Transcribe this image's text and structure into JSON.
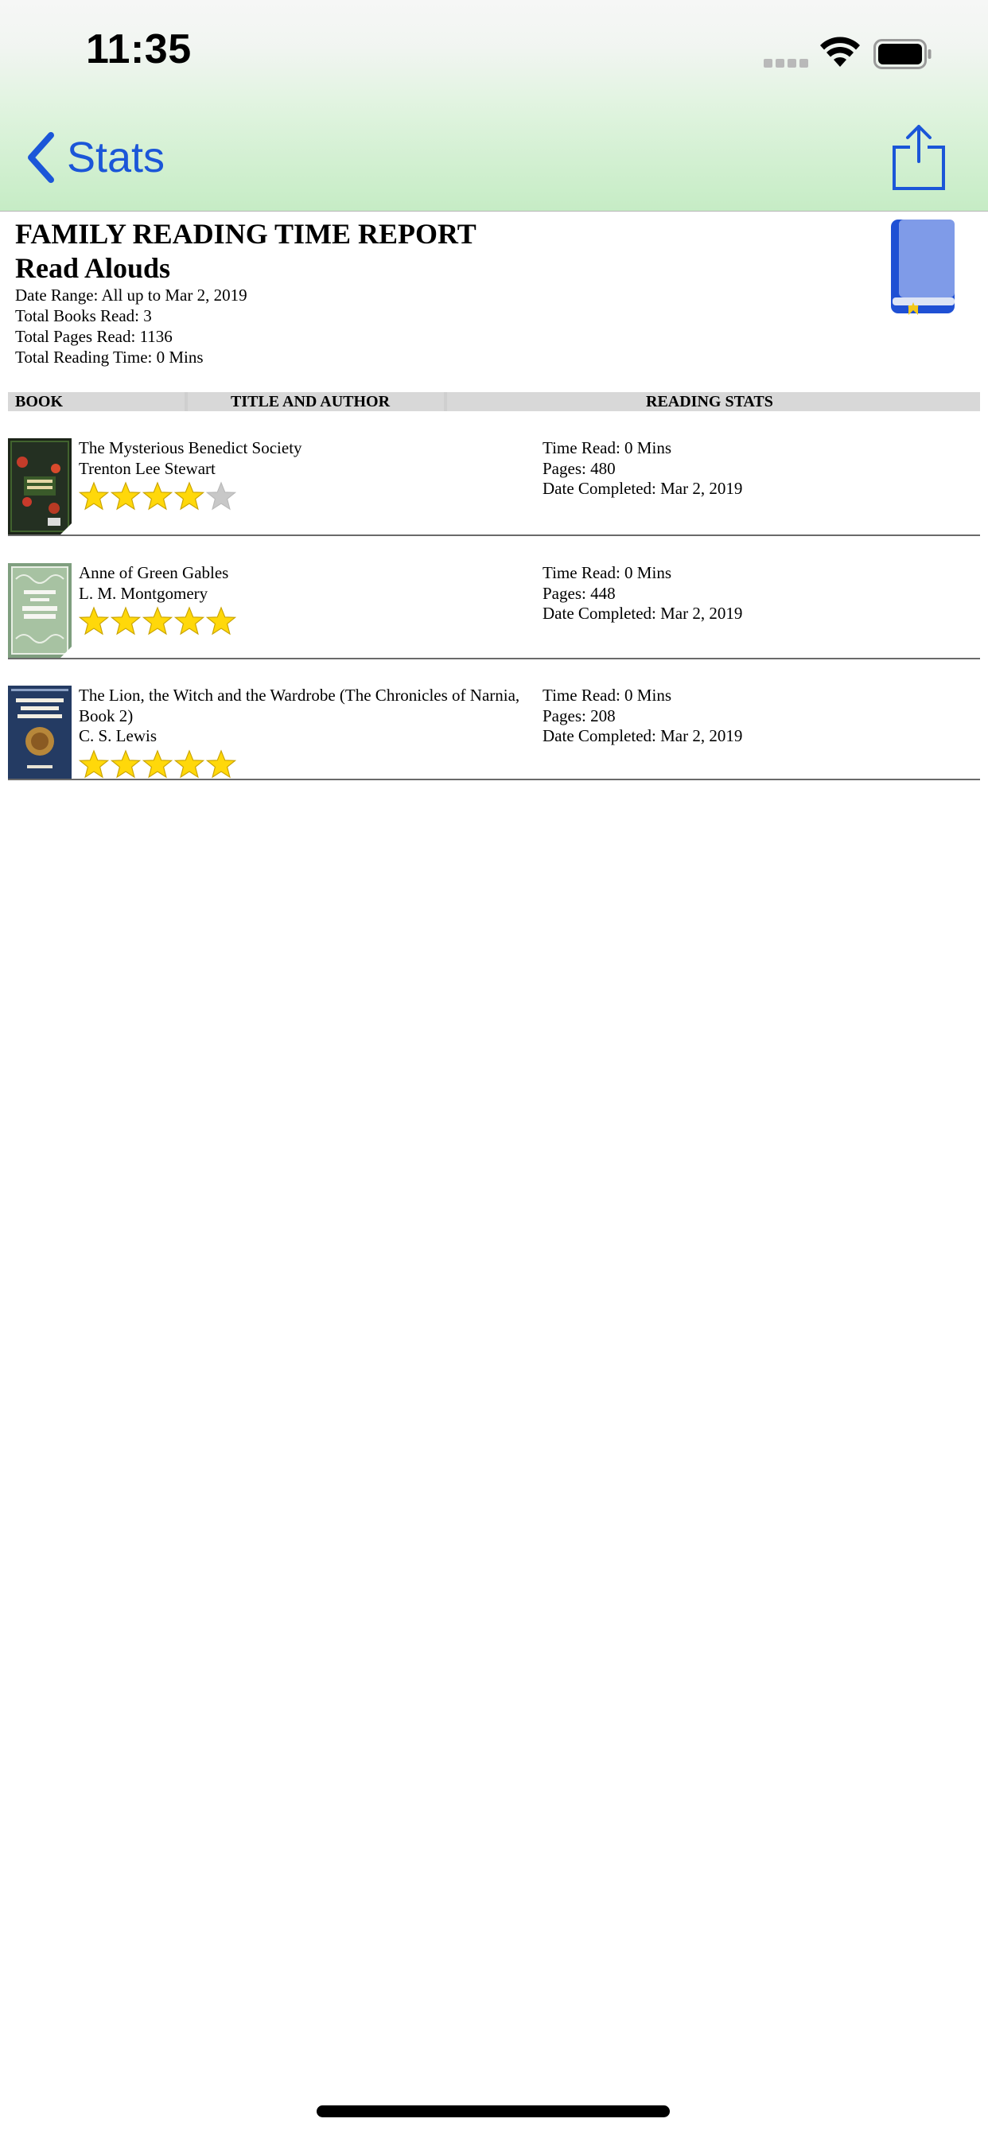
{
  "status_bar": {
    "time": "11:35"
  },
  "nav": {
    "back_label": "Stats",
    "share_icon": "share-icon"
  },
  "report": {
    "title": "FAMILY READING TIME REPORT",
    "subtitle": "Read Alouds",
    "date_range": "Date Range: All up to Mar 2, 2019",
    "total_books": "Total Books Read: 3",
    "total_pages": "Total Pages Read: 1136",
    "total_time": "Total Reading Time: 0 Mins"
  },
  "table": {
    "headers": [
      "BOOK",
      "TITLE AND AUTHOR",
      "READING STATS"
    ],
    "rows": [
      {
        "title": "The Mysterious Benedict Society",
        "author": "Trenton Lee Stewart",
        "rating": 4,
        "time_read": "Time Read: 0 Mins",
        "pages": "Pages: 480",
        "date_completed": "Date Completed: Mar 2, 2019"
      },
      {
        "title": "Anne of Green Gables",
        "author": "L. M. Montgomery",
        "rating": 5,
        "time_read": "Time Read: 0 Mins",
        "pages": "Pages: 448",
        "date_completed": "Date Completed: Mar 2, 2019"
      },
      {
        "title": "The Lion, the Witch and the Wardrobe (The Chronicles of Narnia, Book 2)",
        "author": "C. S. Lewis",
        "rating": 5,
        "time_read": "Time Read: 0 Mins",
        "pages": "Pages: 208",
        "date_completed": "Date Completed: Mar 2, 2019"
      }
    ]
  },
  "colors": {
    "accent": "#1b56d8",
    "star": "#ffd80a",
    "star_empty": "#c8c8c8",
    "header_bg": "#d8d8d8"
  }
}
